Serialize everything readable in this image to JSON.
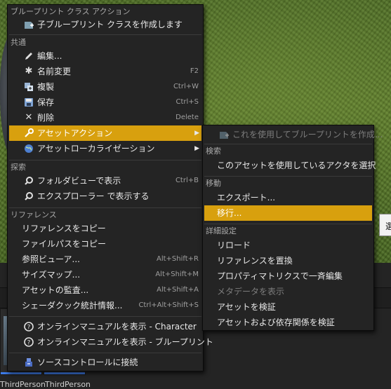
{
  "main_menu": {
    "sections": {
      "blueprint_class_actions": "ブループリント クラス アクション",
      "common": "共通",
      "explore": "探索",
      "references": "リファレンス"
    },
    "items": {
      "create_child_blueprint": "子ブループリント クラスを作成します",
      "edit": "編集...",
      "rename": "名前変更",
      "rename_shortcut": "F2",
      "duplicate": "複製",
      "duplicate_shortcut": "Ctrl+W",
      "save": "保存",
      "save_shortcut": "Ctrl+S",
      "delete": "削除",
      "delete_shortcut": "Delete",
      "asset_actions": "アセットアクション",
      "asset_localization": "アセットローカライゼーション",
      "show_in_folder_view": "フォルダビューで表示",
      "show_in_folder_view_shortcut": "Ctrl+B",
      "show_in_explorer": "エクスプローラー で表示する",
      "copy_reference": "リファレンスをコピー",
      "copy_file_path": "ファイルパスをコピー",
      "reference_viewer": "参照ビューア...",
      "reference_viewer_shortcut": "Alt+Shift+R",
      "size_map": "サイズマップ...",
      "size_map_shortcut": "Alt+Shift+M",
      "audit_assets": "アセットの監査...",
      "audit_assets_shortcut": "Alt+Shift+A",
      "shader_cook_stats": "シェーダクック統計情報...",
      "shader_cook_stats_shortcut": "Ctrl+Alt+Shift+S",
      "online_manual_character": "オンラインマニュアルを表示 - Character",
      "online_manual_blueprint": "オンラインマニュアルを表示 - ブループリント",
      "source_control_connect": "ソースコントロールに接続"
    }
  },
  "sub_menu": {
    "sections": {
      "search": "検索",
      "migrate": "移動",
      "advanced": "詳細設定"
    },
    "items": {
      "create_blueprint_using": "これを使用してブループリントを作成...",
      "select_actors_using": "このアセットを使用しているアクタを選択",
      "export": "エクスポート...",
      "migrate": "移行...",
      "reload": "リロード",
      "replace_references": "リファレンスを置換",
      "property_matrix": "プロパティマトリクスで一斉編集",
      "show_metadata": "メタデータを表示",
      "validate_asset": "アセットを検証",
      "validate_asset_and_deps": "アセットおよび依存関係を検証"
    }
  },
  "content_browser": {
    "assets": [
      "ThirdPerson",
      "ThirdPerson"
    ],
    "partial_dialog_text": "選"
  },
  "colors": {
    "highlight": "#d8a00e",
    "menu_bg": "#242424",
    "asset_bar": "#3d7be8"
  }
}
